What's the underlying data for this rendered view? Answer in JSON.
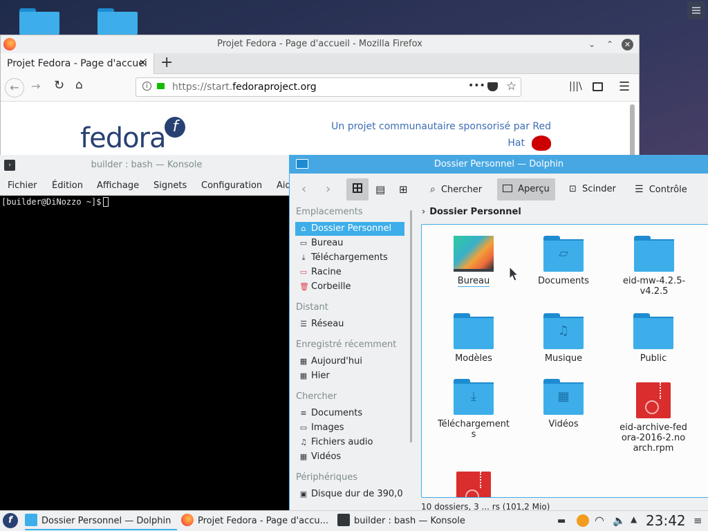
{
  "firefox": {
    "window_title": "Projet Fedora - Page d'accueil - Mozilla Firefox",
    "tab_label": "Projet Fedora - Page d'accuei",
    "url_prefix": "https://start.",
    "url_domain": "fedoraproject.org",
    "logo_text": "fedora",
    "tagline_line1": "Un projet communautaire sponsorisé par Red",
    "tagline_line2": "Hat"
  },
  "konsole": {
    "window_title": "builder : bash — Konsole",
    "menu": [
      "Fichier",
      "Édition",
      "Affichage",
      "Signets",
      "Configuration",
      "Aid"
    ],
    "prompt": "[builder@DiNozzo ~]$"
  },
  "dolphin": {
    "window_title": "Dossier Personnel — Dolphin",
    "toolbar": {
      "search": "Chercher",
      "preview": "Aperçu",
      "split": "Scinder",
      "control": "Contrôle"
    },
    "breadcrumb": "Dossier Personnel",
    "places_headers": [
      "Emplacements",
      "Distant",
      "Enregistré récemment",
      "Chercher",
      "Périphériques"
    ],
    "places": [
      "Dossier Personnel",
      "Bureau",
      "Téléchargements",
      "Racine",
      "Corbeille"
    ],
    "remote": [
      "Réseau"
    ],
    "recent": [
      "Aujourd'hui",
      "Hier"
    ],
    "search": [
      "Documents",
      "Images",
      "Fichiers audio",
      "Vidéos"
    ],
    "devices": [
      "Disque dur de 390,0"
    ],
    "files": [
      {
        "name": "Bureau",
        "kind": "wallpaper"
      },
      {
        "name": "Documents",
        "kind": "folder"
      },
      {
        "name": "eid-mw-4.2.5-v4.2.5",
        "kind": "folder"
      },
      {
        "name": "Modèles",
        "kind": "folder"
      },
      {
        "name": "Musique",
        "kind": "folder"
      },
      {
        "name": "Public",
        "kind": "folder"
      },
      {
        "name": "Téléchargements",
        "kind": "folder"
      },
      {
        "name": "Vidéos",
        "kind": "folder"
      },
      {
        "name": "eid-archive-fedora-2016-2.noarch.rpm",
        "kind": "archive"
      }
    ],
    "status": "10 dossiers, 3 ... rs (101,2 Mio)"
  },
  "taskbar": {
    "tasks": [
      "Dossier Personnel — Dolphin",
      "Projet Fedora - Page d'accu...",
      "builder : bash — Konsole"
    ],
    "clock": "23:42"
  },
  "colors": {
    "accent": "#3daee9",
    "fedora_blue": "#294172",
    "archive_red": "#da2d2d"
  }
}
